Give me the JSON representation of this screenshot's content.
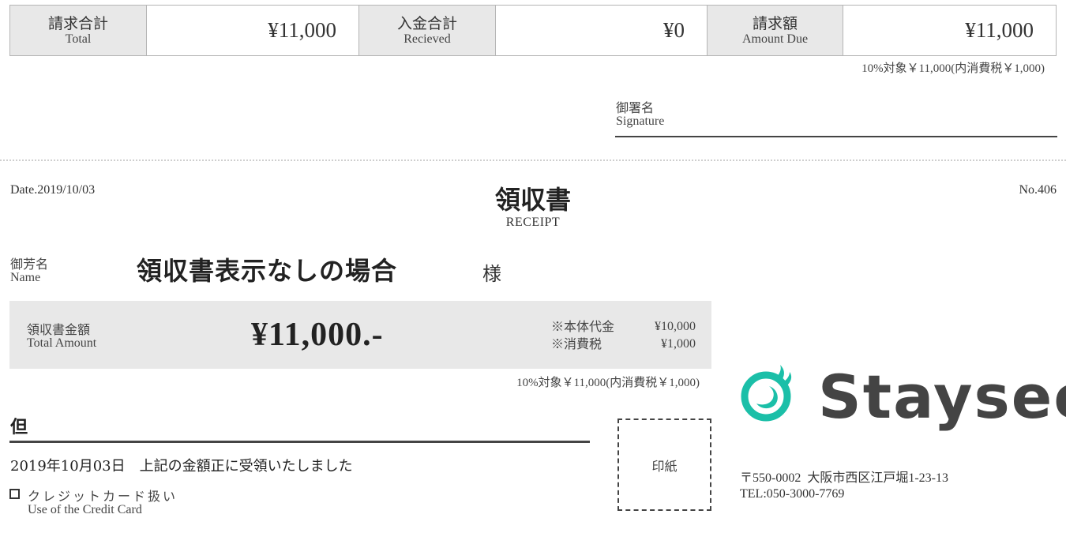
{
  "summary": {
    "total": {
      "label_jp": "請求合計",
      "label_en": "Total",
      "value": "¥11,000"
    },
    "received": {
      "label_jp": "入金合計",
      "label_en": "Recieved",
      "value": "¥0"
    },
    "due": {
      "label_jp": "請求額",
      "label_en": "Amount Due",
      "value": "¥11,000"
    },
    "tax_note": "10%対象￥11,000(内消費税￥1,000)"
  },
  "signature": {
    "label_jp": "御署名",
    "label_en": "Signature"
  },
  "receipt": {
    "date": "Date.2019/10/03",
    "number": "No.406",
    "title_jp": "領収書",
    "title_en": "RECEIPT",
    "name_label_jp": "御芳名",
    "name_label_en": "Name",
    "name_value": "領収書表示なしの場合",
    "honorific": "様",
    "amount_label_jp": "領収書金額",
    "amount_label_en": "Total Amount",
    "amount_value": "¥11,000.-",
    "breakdown": [
      {
        "label": "※本体代金",
        "value": "¥10,000"
      },
      {
        "label": "※消費税",
        "value": "¥1,000"
      }
    ],
    "tax_note": "10%対象￥11,000(内消費税￥1,000)",
    "proviso_label": "但",
    "received_statement": "2019年10月03日　上記の金額正に受領いたしました",
    "credit_card_checked": false,
    "credit_card_jp": "クレジットカード扱い",
    "credit_card_en": "Use of the Credit Card",
    "stamp_label": "印紙"
  },
  "company": {
    "logo_text": "Staysee",
    "brand_color": "#1bbfa8",
    "text_color": "#444444",
    "address": "〒550-0002  大阪市西区江戸堀1-23-13",
    "tel": "TEL:050-3000-7769"
  }
}
